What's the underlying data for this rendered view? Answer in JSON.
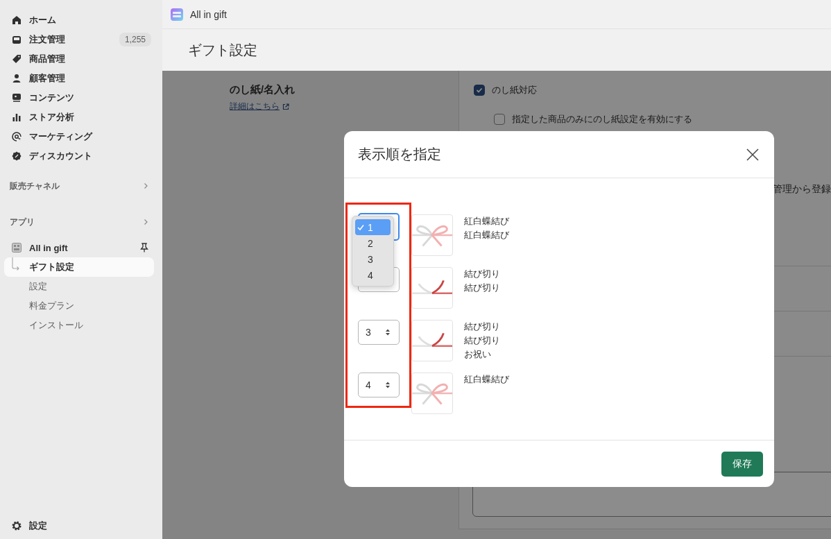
{
  "sidebar": {
    "nav": [
      {
        "label": "ホーム"
      },
      {
        "label": "注文管理",
        "badge": "1,255"
      },
      {
        "label": "商品管理"
      },
      {
        "label": "顧客管理"
      },
      {
        "label": "コンテンツ"
      },
      {
        "label": "ストア分析"
      },
      {
        "label": "マーケティング"
      },
      {
        "label": "ディスカウント"
      }
    ],
    "sections": [
      {
        "label": "販売チャネル"
      },
      {
        "label": "アプリ"
      }
    ],
    "app": {
      "name": "All in gift",
      "children": [
        {
          "label": "ギフト設定",
          "selected": true
        },
        {
          "label": "設定",
          "selected": false
        },
        {
          "label": "料金プラン",
          "selected": false
        },
        {
          "label": "インストール",
          "selected": false
        }
      ]
    },
    "footer": {
      "label": "設定"
    }
  },
  "topbar": {
    "app_name": "All in gift"
  },
  "page_title": "ギフト設定",
  "background": {
    "section_title": "のし紙/名入れ",
    "link": "詳細はこちら",
    "checkboxes": [
      {
        "label": "のし紙対応",
        "checked": true
      },
      {
        "label": "指定した商品のみにのし紙設定を有効にする",
        "checked": false
      }
    ],
    "clipped_text": "管理から登録"
  },
  "modal": {
    "title": "表示順を指定",
    "rows": [
      {
        "kind": "bow",
        "select": {
          "focused": true
        },
        "lines": [
          "紅白蝶結び",
          "紅白蝶結び"
        ],
        "dropdown": [
          {
            "label": "1",
            "selected": true
          },
          {
            "label": "2",
            "selected": false
          },
          {
            "label": "3",
            "selected": false
          },
          {
            "label": "4",
            "selected": false
          }
        ]
      },
      {
        "kind": "knot",
        "select": {
          "focused": false
        },
        "lines": [
          "結び切り",
          "結び切り"
        ]
      },
      {
        "kind": "knot",
        "select": {
          "focused": false,
          "value": "3"
        },
        "lines": [
          "結び切り",
          "結び切り",
          "お祝い"
        ]
      },
      {
        "kind": "bow",
        "select": {
          "focused": false,
          "value": "4"
        },
        "lines": [
          "紅白蝶結び"
        ]
      }
    ],
    "save": "保存"
  }
}
